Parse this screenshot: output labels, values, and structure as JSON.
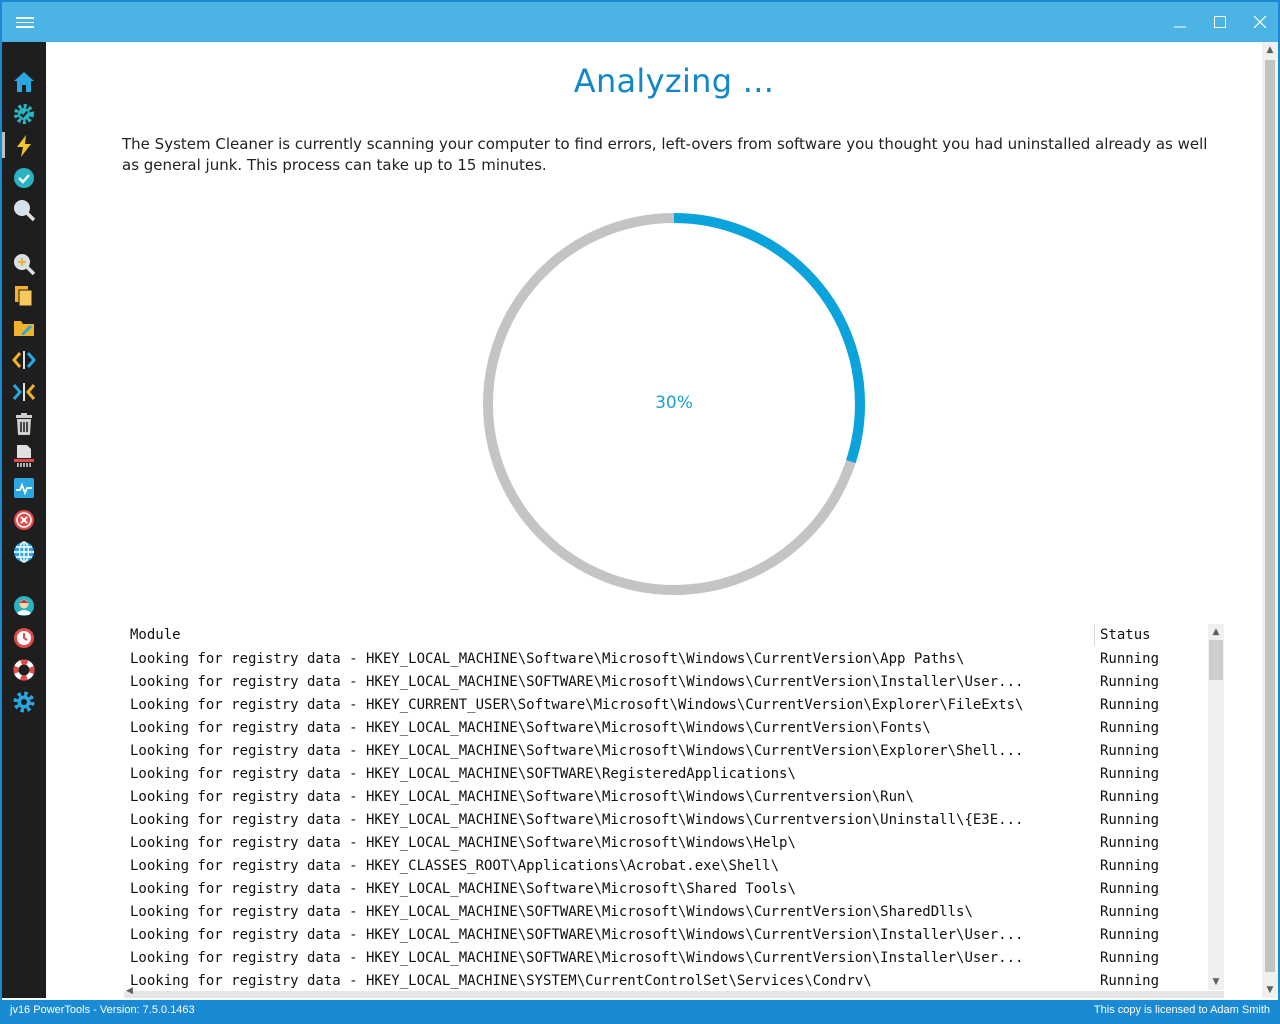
{
  "window": {
    "menu_icon": "hamburger-icon",
    "controls": [
      "minimize-icon",
      "maximize-icon",
      "close-icon"
    ]
  },
  "sidebar": {
    "items": [
      {
        "icon": "home-icon",
        "color": "#2aa6e0"
      },
      {
        "icon": "gear-check-icon",
        "color": "#2ab3c0"
      },
      {
        "icon": "lightning-icon",
        "color": "#f2c32b",
        "active": true
      },
      {
        "icon": "checkmark-circle-icon",
        "color": "#2ab3c0"
      },
      {
        "icon": "magnifier-icon",
        "color": "#e0e0e0"
      },
      {
        "icon": "magnifier-plus-icon",
        "color": "#e0e0e0"
      },
      {
        "icon": "documents-icon",
        "color": "#f2b32b"
      },
      {
        "icon": "folder-edit-icon",
        "color": "#f2b32b"
      },
      {
        "icon": "code-split-icon",
        "color": "#f2b32b"
      },
      {
        "icon": "merge-arrows-icon",
        "color": "#2aa6e0"
      },
      {
        "icon": "trash-icon",
        "color": "#cfcfcf"
      },
      {
        "icon": "shredder-icon",
        "color": "#e0e0e0"
      },
      {
        "icon": "monitor-activity-icon",
        "color": "#2aa6e0"
      },
      {
        "icon": "cancel-circle-icon",
        "color": "#e24b4b"
      },
      {
        "icon": "globe-icon",
        "color": "#2aa6e0"
      },
      {
        "icon": "user-support-icon",
        "color": "#2ab3c0"
      },
      {
        "icon": "clock-icon",
        "color": "#e24b4b"
      },
      {
        "icon": "lifebuoy-icon",
        "color": "#e24b4b"
      },
      {
        "icon": "settings-gear-icon",
        "color": "#2aa6e0"
      }
    ]
  },
  "main": {
    "heading": "Analyzing ...",
    "description": "The System Cleaner is currently scanning your computer to find errors, left-overs from software you thought you had uninstalled already as well as general junk. This process can take up to 15 minutes.",
    "progress": {
      "label": "30%",
      "value": 0.3,
      "color": "#0aa3dc",
      "track_color": "#c4c4c4"
    }
  },
  "table": {
    "columns": [
      "Module",
      "Status"
    ],
    "rows": [
      {
        "module": "Looking for registry data - HKEY_LOCAL_MACHINE\\Software\\Microsoft\\Windows\\CurrentVersion\\App Paths\\",
        "status": "Running"
      },
      {
        "module": "Looking for registry data - HKEY_LOCAL_MACHINE\\SOFTWARE\\Microsoft\\Windows\\CurrentVersion\\Installer\\User...",
        "status": "Running"
      },
      {
        "module": "Looking for registry data - HKEY_CURRENT_USER\\Software\\Microsoft\\Windows\\CurrentVersion\\Explorer\\FileExts\\",
        "status": "Running"
      },
      {
        "module": "Looking for registry data - HKEY_LOCAL_MACHINE\\Software\\Microsoft\\Windows\\CurrentVersion\\Fonts\\",
        "status": "Running"
      },
      {
        "module": "Looking for registry data - HKEY_LOCAL_MACHINE\\Software\\Microsoft\\Windows\\CurrentVersion\\Explorer\\Shell...",
        "status": "Running"
      },
      {
        "module": "Looking for registry data - HKEY_LOCAL_MACHINE\\SOFTWARE\\RegisteredApplications\\",
        "status": "Running"
      },
      {
        "module": "Looking for registry data - HKEY_LOCAL_MACHINE\\Software\\Microsoft\\Windows\\Currentversion\\Run\\",
        "status": "Running"
      },
      {
        "module": "Looking for registry data - HKEY_LOCAL_MACHINE\\Software\\Microsoft\\Windows\\Currentversion\\Uninstall\\{E3E...",
        "status": "Running"
      },
      {
        "module": "Looking for registry data - HKEY_LOCAL_MACHINE\\Software\\Microsoft\\Windows\\Help\\",
        "status": "Running"
      },
      {
        "module": "Looking for registry data - HKEY_CLASSES_ROOT\\Applications\\Acrobat.exe\\Shell\\",
        "status": "Running"
      },
      {
        "module": "Looking for registry data - HKEY_LOCAL_MACHINE\\Software\\Microsoft\\Shared Tools\\",
        "status": "Running"
      },
      {
        "module": "Looking for registry data - HKEY_LOCAL_MACHINE\\SOFTWARE\\Microsoft\\Windows\\CurrentVersion\\SharedDlls\\",
        "status": "Running"
      },
      {
        "module": "Looking for registry data - HKEY_LOCAL_MACHINE\\SOFTWARE\\Microsoft\\Windows\\CurrentVersion\\Installer\\User...",
        "status": "Running"
      },
      {
        "module": "Looking for registry data - HKEY_LOCAL_MACHINE\\SOFTWARE\\Microsoft\\Windows\\CurrentVersion\\Installer\\User...",
        "status": "Running"
      },
      {
        "module": "Looking for registry data - HKEY_LOCAL_MACHINE\\SYSTEM\\CurrentControlSet\\Services\\Condrv\\",
        "status": "Running"
      }
    ]
  },
  "statusbar": {
    "left": "jv16 PowerTools - Version: 7.5.0.1463",
    "right": "This copy is licensed to Adam Smith"
  }
}
